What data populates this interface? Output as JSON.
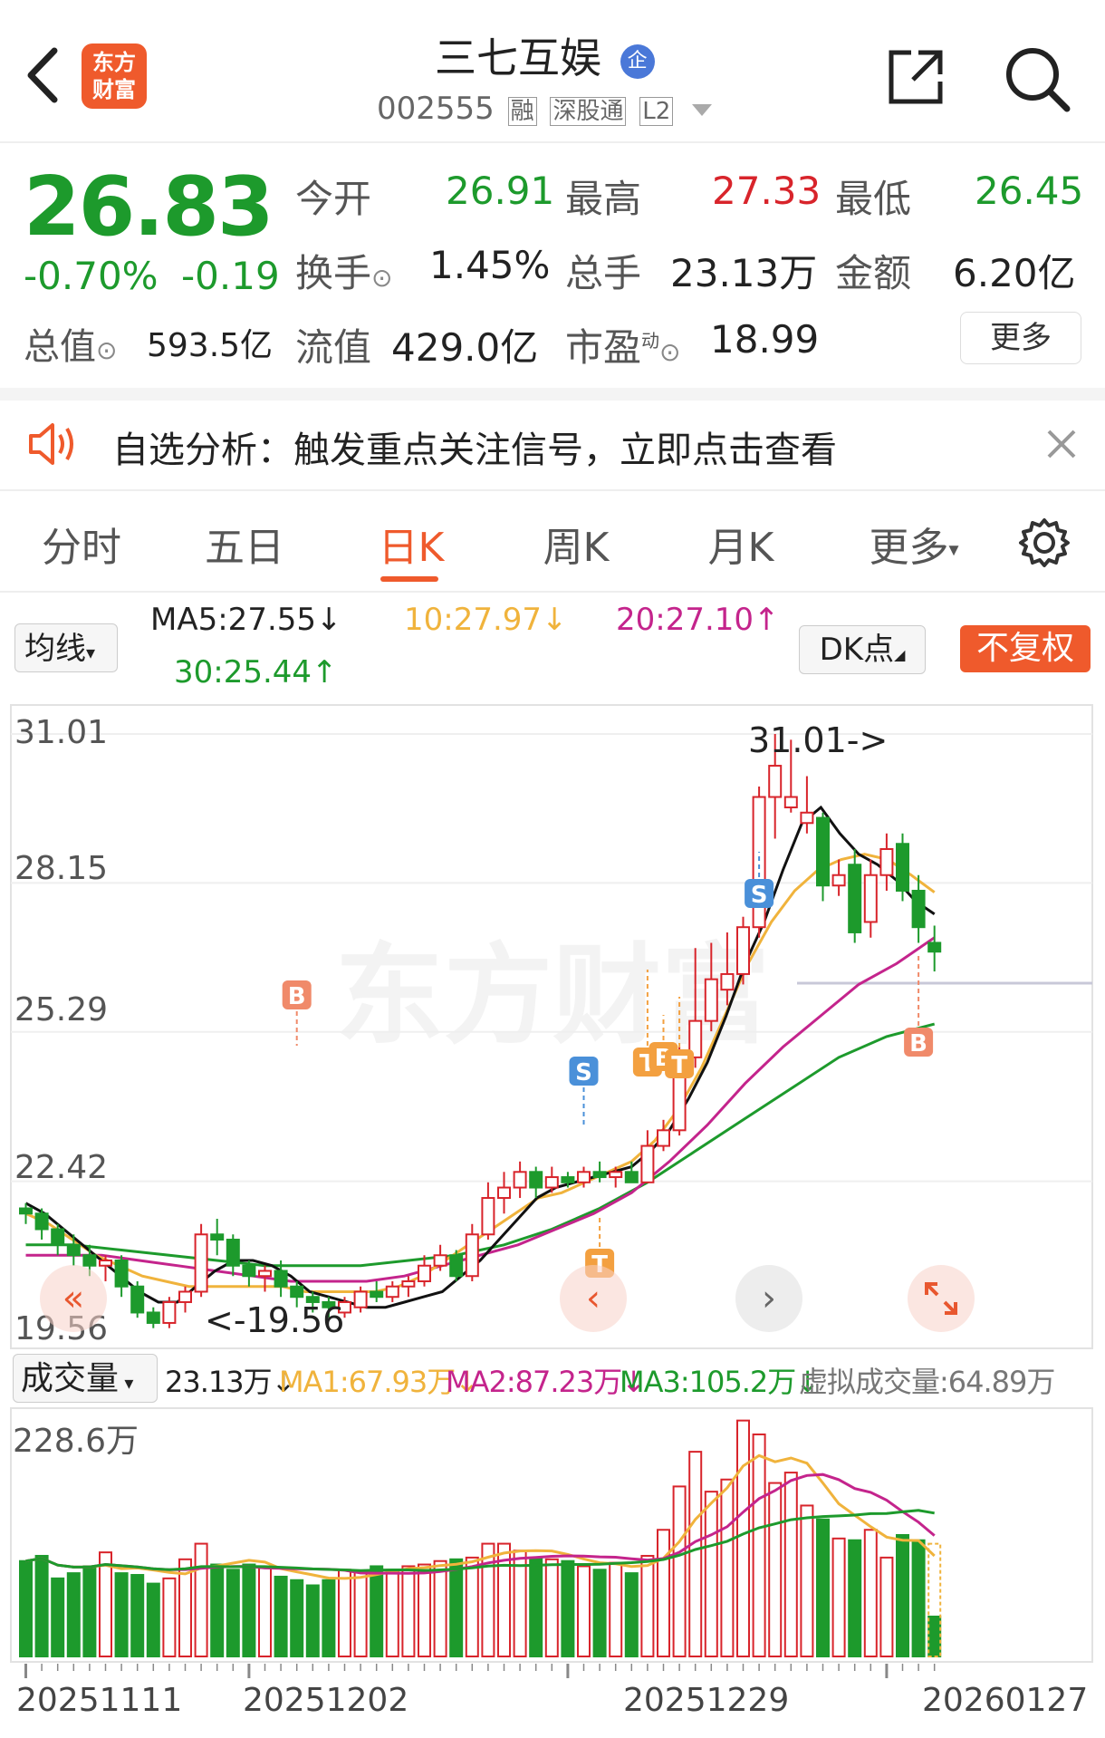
{
  "header": {
    "title": "三七互娱",
    "title_badge": "企",
    "code": "002555",
    "tags": [
      "融",
      "深股通",
      "L2"
    ],
    "logo_line1": "东方",
    "logo_line2": "财富"
  },
  "quote": {
    "price": "26.83",
    "change_pct": "-0.70%",
    "change": "-0.19",
    "open_label": "今开",
    "open": "26.91",
    "high_label": "最高",
    "high": "27.33",
    "low_label": "最低",
    "low": "26.45",
    "turnover_label": "换手",
    "turnover": "1.45%",
    "volume_label": "总手",
    "volume": "23.13万",
    "amount_label": "金额",
    "amount": "6.20亿",
    "mktcap_label": "总值",
    "mktcap": "593.5亿",
    "float_label": "流值",
    "float_cap": "429.0亿",
    "pe_label": "市盈",
    "pe_sup": "动",
    "pe": "18.99",
    "more_label": "更多"
  },
  "notice": {
    "text": "自选分析：触发重点关注信号，立即点击查看"
  },
  "tabs": [
    "分时",
    "五日",
    "日K",
    "周K",
    "月K",
    "更多"
  ],
  "active_tab": "日K",
  "ma_bar": {
    "selector": "均线",
    "ma5": "MA5:27.55↓",
    "ma10": "10:27.97↓",
    "ma20": "20:27.10↑",
    "ma30": "30:25.44↑",
    "dk": "DK点",
    "adjust": "不复权"
  },
  "kline": {
    "y_labels": [
      "31.01",
      "28.15",
      "25.29",
      "22.42",
      "19.56"
    ],
    "high_marker": "31.01->",
    "low_marker": "<-19.56",
    "watermark": "东方财富"
  },
  "volume_bar": {
    "selector": "成交量",
    "vol": "23.13万↓",
    "ma1": "MA1:67.93万↓",
    "ma2": "MA2:87.23万↓",
    "ma3": "MA3:105.2万↓",
    "virtual": "虚拟成交量:64.89万",
    "top_label": "228.6万"
  },
  "dates": [
    "20251111",
    "20251202",
    "20251229",
    "20260127"
  ],
  "colors": {
    "up": "#d8242b",
    "down": "#1d9a2c",
    "accent": "#ef5a2c",
    "ma5": "#111111",
    "ma10": "#f0b33c",
    "ma20": "#c4248c",
    "ma30": "#1d9a2c"
  },
  "chart_data": {
    "type": "candlestick",
    "ylim": [
      19.56,
      31.01
    ],
    "candles": [
      [
        21.9,
        21.8,
        22.0,
        21.6
      ],
      [
        21.8,
        21.5,
        21.9,
        21.3
      ],
      [
        21.5,
        21.2,
        21.6,
        21.0
      ],
      [
        21.2,
        21.0,
        21.4,
        20.8
      ],
      [
        21.0,
        20.8,
        21.2,
        20.6
      ],
      [
        20.8,
        20.9,
        21.0,
        20.5
      ],
      [
        20.9,
        20.4,
        21.0,
        20.2
      ],
      [
        20.4,
        19.9,
        20.5,
        19.8
      ],
      [
        19.9,
        19.7,
        20.0,
        19.6
      ],
      [
        19.7,
        20.1,
        20.2,
        19.6
      ],
      [
        20.1,
        20.3,
        20.4,
        19.9
      ],
      [
        20.3,
        21.4,
        21.6,
        20.2
      ],
      [
        21.4,
        21.3,
        21.7,
        21.0
      ],
      [
        21.3,
        20.8,
        21.4,
        20.6
      ],
      [
        20.8,
        20.6,
        20.9,
        20.4
      ],
      [
        20.6,
        20.7,
        20.8,
        20.3
      ],
      [
        20.7,
        20.4,
        20.9,
        20.2
      ],
      [
        20.4,
        20.2,
        20.5,
        20.0
      ],
      [
        20.2,
        20.1,
        20.3,
        19.9
      ],
      [
        20.1,
        20.0,
        20.2,
        19.8
      ],
      [
        19.9,
        20.1,
        20.2,
        19.8
      ],
      [
        20.0,
        20.3,
        20.4,
        19.9
      ],
      [
        20.3,
        20.2,
        20.5,
        20.1
      ],
      [
        20.2,
        20.4,
        20.5,
        20.1
      ],
      [
        20.4,
        20.5,
        20.6,
        20.2
      ],
      [
        20.5,
        20.8,
        21.0,
        20.4
      ],
      [
        20.8,
        21.0,
        21.2,
        20.7
      ],
      [
        21.0,
        20.6,
        21.1,
        20.5
      ],
      [
        20.6,
        21.4,
        21.6,
        20.5
      ],
      [
        21.4,
        22.1,
        22.4,
        21.3
      ],
      [
        22.1,
        22.3,
        22.6,
        21.8
      ],
      [
        22.3,
        22.6,
        22.8,
        22.1
      ],
      [
        22.6,
        22.3,
        22.7,
        22.1
      ],
      [
        22.3,
        22.5,
        22.7,
        22.2
      ],
      [
        22.5,
        22.4,
        22.6,
        22.3
      ],
      [
        22.4,
        22.6,
        22.7,
        22.3
      ],
      [
        22.6,
        22.5,
        22.8,
        22.4
      ],
      [
        22.5,
        22.6,
        22.7,
        22.3
      ],
      [
        22.6,
        22.4,
        22.8,
        22.4
      ],
      [
        22.4,
        23.1,
        23.4,
        22.4
      ],
      [
        23.1,
        23.4,
        23.6,
        23.0
      ],
      [
        23.4,
        24.8,
        25.0,
        23.3
      ],
      [
        24.8,
        25.5,
        26.9,
        24.6
      ],
      [
        25.5,
        26.3,
        27.0,
        25.3
      ],
      [
        26.1,
        26.4,
        27.2,
        25.8
      ],
      [
        26.4,
        27.3,
        27.5,
        26.2
      ],
      [
        27.3,
        29.8,
        30.0,
        27.1
      ],
      [
        29.8,
        30.4,
        31.01,
        29.0
      ],
      [
        29.6,
        29.8,
        30.9,
        29.5
      ],
      [
        29.3,
        29.5,
        30.2,
        29.1
      ],
      [
        29.4,
        28.1,
        29.5,
        27.8
      ],
      [
        28.1,
        28.3,
        28.6,
        27.9
      ],
      [
        28.5,
        27.2,
        28.8,
        27.0
      ],
      [
        27.4,
        28.3,
        28.6,
        27.1
      ],
      [
        28.3,
        28.8,
        29.1,
        28.0
      ],
      [
        28.9,
        28.0,
        29.1,
        27.8
      ],
      [
        28.0,
        27.3,
        28.3,
        27.0
      ],
      [
        27.0,
        26.83,
        27.33,
        26.45
      ]
    ],
    "volumes": [
      55,
      58,
      45,
      48,
      52,
      60,
      48,
      47,
      42,
      45,
      56,
      65,
      53,
      50,
      53,
      51,
      46,
      44,
      41,
      44,
      50,
      49,
      52,
      50,
      52,
      53,
      55,
      56,
      57,
      65,
      65,
      61,
      57,
      56,
      55,
      52,
      50,
      54,
      48,
      58,
      73,
      98,
      118,
      95,
      102,
      136,
      128,
      100,
      106,
      87,
      79,
      68,
      67,
      73,
      57,
      70,
      67,
      23
    ],
    "ma5_line": [
      22.0,
      21.8,
      21.5,
      21.2,
      20.9,
      20.6,
      20.3,
      20.1,
      20.1,
      20.4,
      20.7,
      20.9,
      20.9,
      20.8,
      20.6,
      20.3,
      20.2,
      20.1,
      20.0,
      20.0,
      20.1,
      20.2,
      20.3,
      20.6,
      20.9,
      21.3,
      21.7,
      22.1,
      22.3,
      22.4,
      22.5,
      22.6,
      22.7,
      23.0,
      23.4,
      24.0,
      24.7,
      25.6,
      26.6,
      27.4,
      28.4,
      29.3,
      29.6,
      29.1,
      28.7,
      28.5,
      28.2,
      27.8,
      27.55
    ],
    "ma10_line": [
      21.8,
      21.6,
      21.3,
      21.0,
      20.8,
      20.6,
      20.5,
      20.4,
      20.4,
      20.4,
      20.4,
      20.4,
      20.3,
      20.3,
      20.3,
      20.3,
      20.4,
      20.6,
      20.9,
      21.2,
      21.5,
      21.8,
      22.1,
      22.2,
      22.4,
      22.6,
      22.8,
      23.2,
      23.8,
      24.6,
      25.6,
      26.6,
      27.4,
      28.0,
      28.4,
      28.6,
      28.7,
      28.6,
      28.3,
      27.97
    ],
    "ma20_line": [
      21.0,
      21.0,
      21.0,
      20.9,
      20.8,
      20.7,
      20.6,
      20.5,
      20.5,
      20.5,
      20.6,
      20.8,
      21.0,
      21.2,
      21.5,
      21.8,
      22.2,
      22.8,
      23.5,
      24.3,
      25.0,
      25.6,
      26.2,
      26.6,
      27.1
    ],
    "ma30_line": [
      21.2,
      21.2,
      21.1,
      21.0,
      20.9,
      20.8,
      20.8,
      20.8,
      20.9,
      21.0,
      21.2,
      21.5,
      21.9,
      22.4,
      23.0,
      23.6,
      24.2,
      24.8,
      25.2,
      25.44
    ]
  }
}
